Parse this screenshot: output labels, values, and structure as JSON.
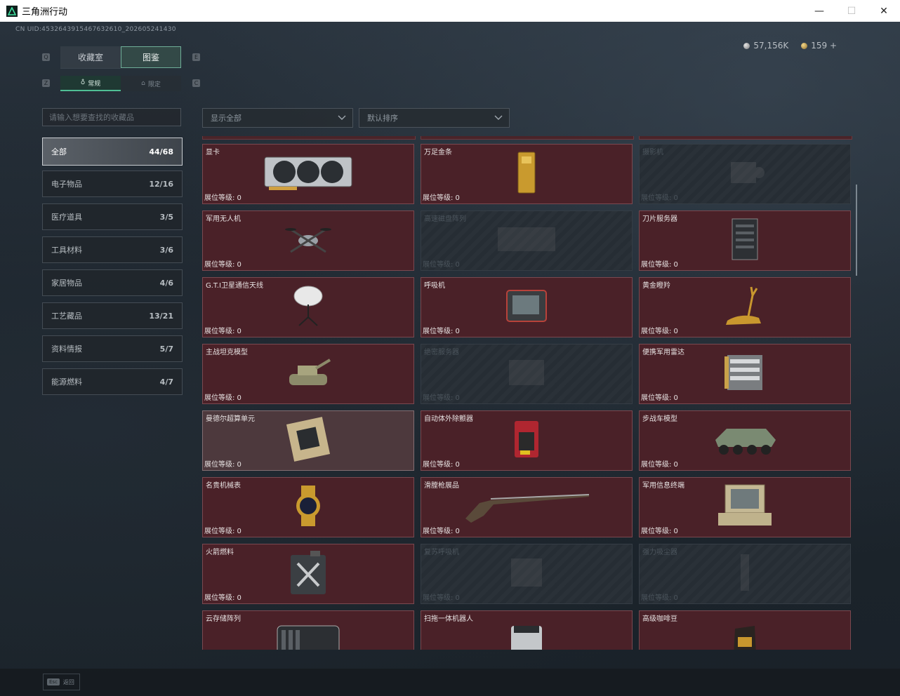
{
  "window": {
    "title": "三角洲行动",
    "minimize": "—",
    "maximize": "☐",
    "close": "✕"
  },
  "uid": "CN UID:4532643915467632610_202605241430",
  "currency": {
    "silver": "57,156K",
    "gold": "159 +"
  },
  "tabs": [
    {
      "label": "收藏室"
    },
    {
      "label": "图鉴",
      "active": true
    }
  ],
  "subtabs": [
    {
      "label": "常规",
      "active": true
    },
    {
      "label": "限定"
    }
  ],
  "key_hints": {
    "q": "Q",
    "e": "E",
    "z": "Z",
    "c": "C"
  },
  "search": {
    "placeholder": "请输入想要查找的收藏品"
  },
  "filters": {
    "display": "显示全部",
    "sort": "默认排序"
  },
  "categories": [
    {
      "label": "全部",
      "count": "44/68",
      "active": true
    },
    {
      "label": "电子物品",
      "count": "12/16"
    },
    {
      "label": "医疗道具",
      "count": "3/5"
    },
    {
      "label": "工具材料",
      "count": "3/6"
    },
    {
      "label": "家居物品",
      "count": "4/6"
    },
    {
      "label": "工艺藏品",
      "count": "13/21"
    },
    {
      "label": "资料情报",
      "count": "5/7"
    },
    {
      "label": "能源燃料",
      "count": "4/7"
    }
  ],
  "items": [
    {
      "name": "显卡",
      "level": "展位等级:  0",
      "state": "owned",
      "icon": "gpu-icon"
    },
    {
      "name": "万足金条",
      "level": "展位等级:  0",
      "state": "owned",
      "icon": "gold-bar-icon"
    },
    {
      "name": "摄影机",
      "level": "展位等级:  0",
      "state": "locked",
      "icon": "camera-icon"
    },
    {
      "name": "军用无人机",
      "level": "展位等级:  0",
      "state": "owned",
      "icon": "drone-icon"
    },
    {
      "name": "高速磁盘阵列",
      "level": "展位等级:  0",
      "state": "locked",
      "icon": "disk-array-icon"
    },
    {
      "name": "刀片服务器",
      "level": "展位等级:  0",
      "state": "owned",
      "icon": "server-icon"
    },
    {
      "name": "G.T.I卫星通信天线",
      "level": "展位等级:  0",
      "state": "owned",
      "icon": "satellite-dish-icon"
    },
    {
      "name": "呼吸机",
      "level": "展位等级:  0",
      "state": "owned",
      "icon": "ventilator-icon"
    },
    {
      "name": "黄金瞪羚",
      "level": "展位等级:  0",
      "state": "owned",
      "icon": "gold-gazelle-icon"
    },
    {
      "name": "主战坦克模型",
      "level": "展位等级:  0",
      "state": "owned",
      "icon": "tank-icon"
    },
    {
      "name": "绝密服务器",
      "level": "展位等级:  0",
      "state": "locked",
      "icon": "secret-server-icon"
    },
    {
      "name": "便携军用雷达",
      "level": "展位等级:  0",
      "state": "owned",
      "icon": "radar-icon"
    },
    {
      "name": "曼德尔超算单元",
      "level": "展位等级:  0",
      "state": "highlighted",
      "icon": "chip-icon"
    },
    {
      "name": "自动体外除颤器",
      "level": "展位等级:  0",
      "state": "owned",
      "icon": "defibrillator-icon"
    },
    {
      "name": "步战车模型",
      "level": "展位等级:  0",
      "state": "owned",
      "icon": "ifv-icon"
    },
    {
      "name": "名贵机械表",
      "level": "展位等级:  0",
      "state": "owned",
      "icon": "watch-icon"
    },
    {
      "name": "滑膛枪展品",
      "level": "展位等级:  0",
      "state": "owned",
      "icon": "musket-icon"
    },
    {
      "name": "军用信息终端",
      "level": "展位等级:  0",
      "state": "owned",
      "icon": "terminal-icon"
    },
    {
      "name": "火箭燃料",
      "level": "展位等级:  0",
      "state": "owned",
      "icon": "fuel-can-icon"
    },
    {
      "name": "复苏呼吸机",
      "level": "展位等级:  0",
      "state": "locked",
      "icon": "resuscitator-icon"
    },
    {
      "name": "强力吸尘器",
      "level": "展位等级:  0",
      "state": "locked",
      "icon": "vacuum-icon"
    },
    {
      "name": "云存储阵列",
      "level": "",
      "state": "owned",
      "icon": "storage-array-icon"
    },
    {
      "name": "扫拖一体机器人",
      "level": "",
      "state": "owned",
      "icon": "robot-vacuum-icon"
    },
    {
      "name": "高级咖啡豆",
      "level": "",
      "state": "owned",
      "icon": "coffee-bag-icon"
    }
  ],
  "footer": {
    "esc_key": "Esc",
    "esc_label": "返回"
  }
}
